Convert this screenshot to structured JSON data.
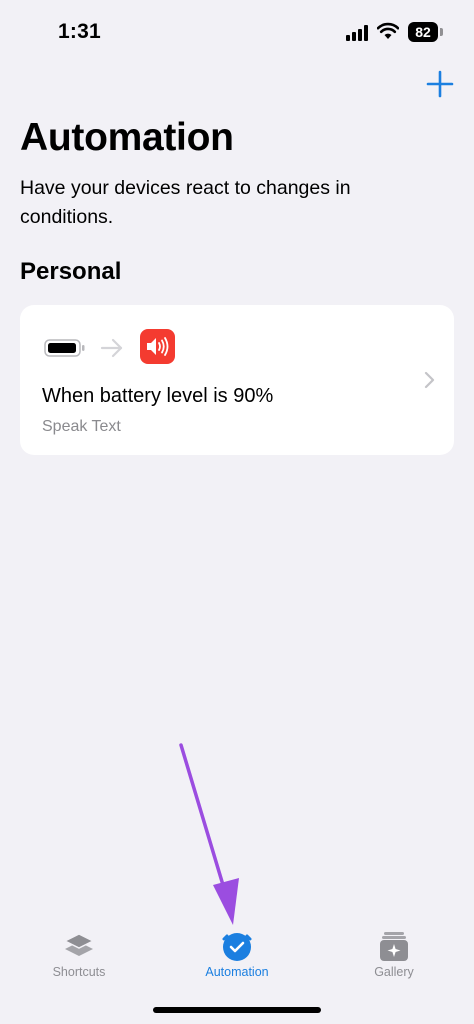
{
  "status_bar": {
    "time": "1:31",
    "battery_level": "82",
    "icons": [
      "signal-icon",
      "wifi-icon",
      "battery-icon"
    ]
  },
  "header": {
    "add_icon": "plus-icon",
    "title": "Automation",
    "subtitle": "Have your devices react to changes in conditions."
  },
  "section": {
    "title": "Personal"
  },
  "automations": [
    {
      "title": "When battery level is 90%",
      "subtitle": "Speak Text",
      "trigger_icon": "battery-icon",
      "action_icon": "speaker-icon",
      "action_color": "#f43b30"
    }
  ],
  "tab_bar": {
    "tabs": [
      {
        "label": "Shortcuts",
        "icon": "layers-icon",
        "active": false
      },
      {
        "label": "Automation",
        "icon": "check-clock-icon",
        "active": true
      },
      {
        "label": "Gallery",
        "icon": "gallery-icon",
        "active": false
      }
    ],
    "accent_color": "#1b7fe0"
  },
  "annotation": {
    "color": "#9b4de0",
    "icon": "pointer-arrow"
  }
}
